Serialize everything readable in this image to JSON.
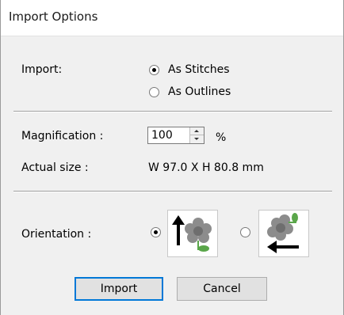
{
  "window": {
    "title": "Import Options"
  },
  "import": {
    "label": "Import:",
    "options": [
      {
        "label": "As Stitches",
        "checked": true
      },
      {
        "label": "As Outlines",
        "checked": false
      }
    ]
  },
  "magnification": {
    "label": "Magnification :",
    "value": "100",
    "unit": "%"
  },
  "actual_size": {
    "label": "Actual size :",
    "value": "W 97.0 X H 80.8 mm"
  },
  "orientation": {
    "label": "Orientation :",
    "options": [
      {
        "icon": "flower-arrow-up-icon",
        "checked": true
      },
      {
        "icon": "flower-arrow-left-icon",
        "checked": false
      }
    ]
  },
  "buttons": {
    "import": "Import",
    "cancel": "Cancel"
  },
  "colors": {
    "flower": "#8c8c8c",
    "leaf": "#5aa64a",
    "arrow": "#000000",
    "default_button_border": "#0078d7"
  }
}
